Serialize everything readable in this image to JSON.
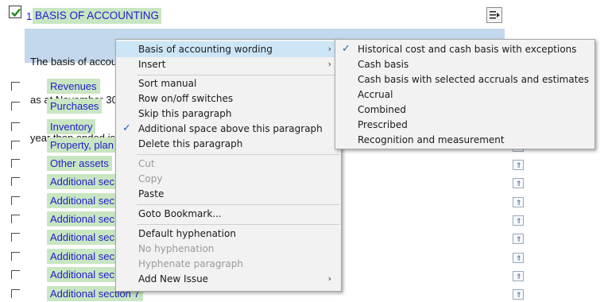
{
  "heading": {
    "number": "1.",
    "title": "BASIS OF ACCOUNTING"
  },
  "paragraph": {
    "lines": [
      "The basis of accounting applied in the preparation of the balance sheet of Jazzit Simple Example Ltd.",
      "as at November 30",
      "year then ended is"
    ]
  },
  "rows": [
    {
      "label": "Revenues"
    },
    {
      "label": "Purchases"
    },
    {
      "label": "Inventory"
    },
    {
      "label": "Property, plan"
    },
    {
      "label": "Other assets"
    },
    {
      "label": "Additional sec"
    },
    {
      "label": "Additional sec"
    },
    {
      "label": "Additional sec"
    },
    {
      "label": "Additional sec"
    },
    {
      "label": "Additional sec"
    },
    {
      "label": "Additional sec"
    },
    {
      "label": "Additional section 7"
    }
  ],
  "context_menu": {
    "items": [
      {
        "label": "Basis of accounting wording",
        "submenu": true,
        "highlighted": true
      },
      {
        "label": "Insert",
        "submenu": true
      },
      {
        "label": "Sort manual"
      },
      {
        "label": "Row on/off switches"
      },
      {
        "label": "Skip this paragraph"
      },
      {
        "label": "Additional space above this paragraph",
        "checked": true
      },
      {
        "label": "Delete this paragraph"
      },
      {
        "label": "Cut",
        "disabled": true
      },
      {
        "label": "Copy",
        "disabled": true
      },
      {
        "label": "Paste"
      },
      {
        "label": "Goto Bookmark..."
      },
      {
        "label": "Default hyphenation"
      },
      {
        "label": "No hyphenation",
        "disabled": true
      },
      {
        "label": "Hyphenate paragraph",
        "disabled": true
      },
      {
        "label": "Add New Issue",
        "submenu": true
      }
    ]
  },
  "submenu": {
    "items": [
      {
        "label": "Historical cost and cash basis with exceptions",
        "checked": true
      },
      {
        "label": "Cash basis"
      },
      {
        "label": "Cash basis with selected accruals and estimates"
      },
      {
        "label": "Accrual"
      },
      {
        "label": "Combined"
      },
      {
        "label": "Prescribed"
      },
      {
        "label": "Recognition and measurement"
      }
    ]
  },
  "colors": {
    "link": "#1d1dcc",
    "label_bg": "#c9e6c2",
    "paragraph_bg": "#c3d8ec",
    "menu_highlight": "#cde6f7"
  },
  "icons": {
    "heading_action": "move-right-icon",
    "row_action": "mouse-edit-icon",
    "check": "checkmark-icon",
    "submenu": "chevron-right-icon"
  }
}
